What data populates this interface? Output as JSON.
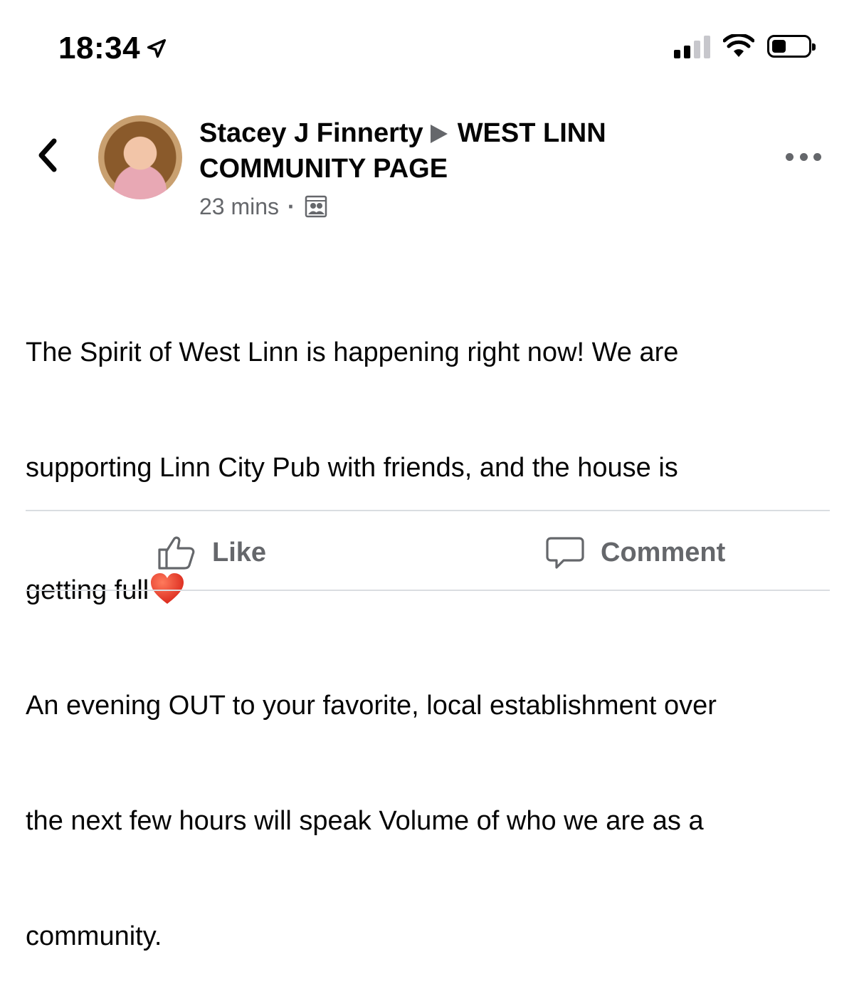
{
  "status_bar": {
    "time": "18:34",
    "signal_bars_active": 2,
    "signal_bars_total": 4,
    "battery_level": 0.4
  },
  "post": {
    "author": "Stacey J Finnerty",
    "group_line1": "WEST LINN",
    "group_line2": "COMMUNITY PAGE",
    "time_ago": "23 mins",
    "separator": "·",
    "privacy_icon": "group-members-icon",
    "body_line1": "The Spirit of West Linn is happening right now! We are",
    "body_line2": "supporting Linn City Pub with friends, and the house is",
    "body_line3": "getting full",
    "body_emoji": "heart-emoji",
    "body_line4": "An evening OUT to your favorite, local establishment over",
    "body_line5": "the next few hours will speak Volume of who we are as a",
    "body_line6": "community."
  },
  "actions": {
    "like_label": "Like",
    "comment_label": "Comment"
  },
  "colors": {
    "text_primary": "#050505",
    "text_secondary": "#65676b",
    "divider": "#dadde1",
    "heart": "#e0301e"
  }
}
